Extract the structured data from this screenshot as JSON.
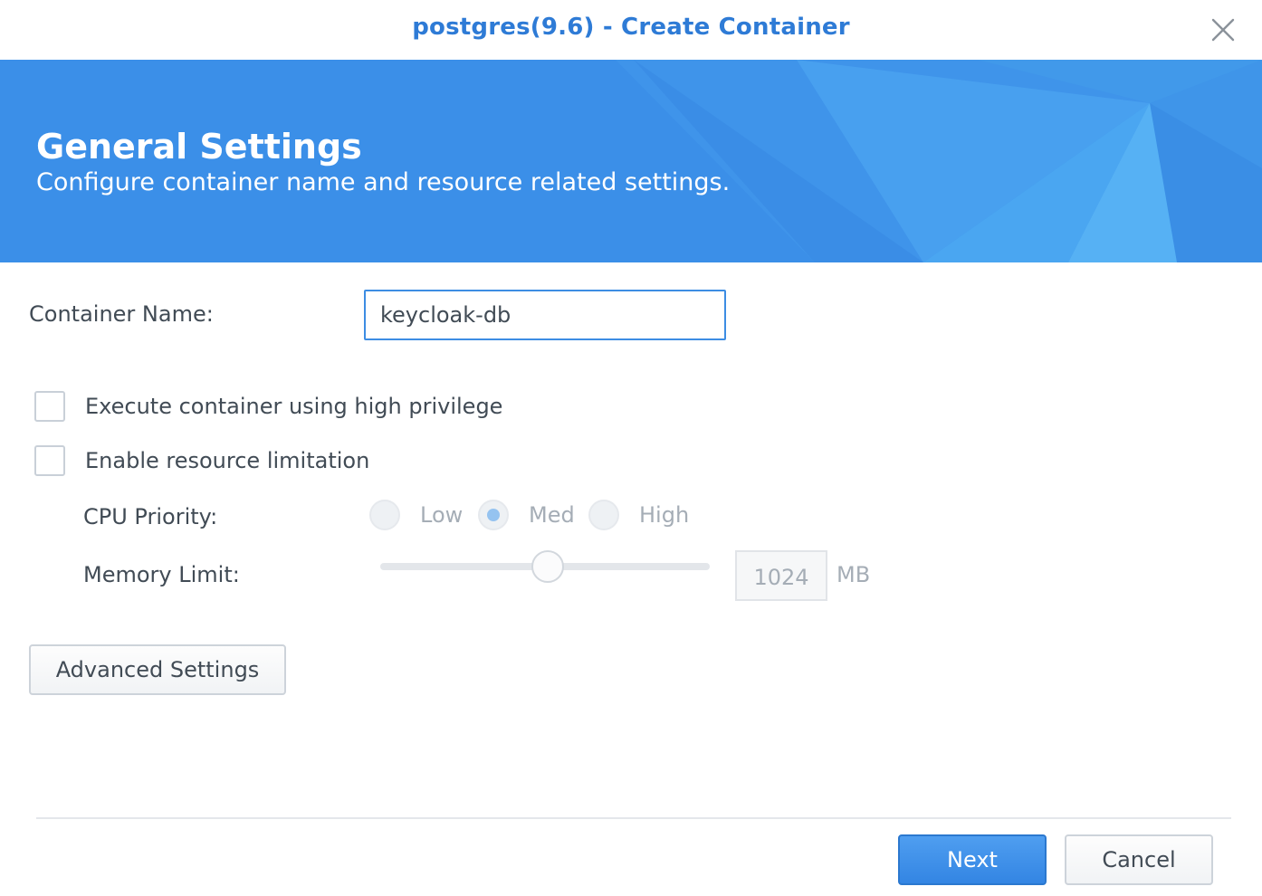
{
  "window": {
    "title": "postgres(9.6) - Create Container",
    "close_icon": "close-icon"
  },
  "banner": {
    "title": "General Settings",
    "subtitle": "Configure container name and resource related settings."
  },
  "form": {
    "container_name_label": "Container Name:",
    "container_name_value": "keycloak-db",
    "high_privilege_label": "Execute container using high privilege",
    "high_privilege_checked": false,
    "resource_limit_label": "Enable resource limitation",
    "resource_limit_checked": false,
    "cpu_priority_label": "CPU Priority:",
    "cpu_priority_options": [
      "Low",
      "Med",
      "High"
    ],
    "cpu_priority_selected": "Med",
    "memory_limit_label": "Memory Limit:",
    "memory_limit_value": "1024",
    "memory_limit_unit": "MB",
    "advanced_settings_label": "Advanced Settings"
  },
  "footer": {
    "next_label": "Next",
    "cancel_label": "Cancel"
  },
  "colors": {
    "accent": "#2e7bd6",
    "banner": "#3b8fe8",
    "primary_button": "#3385e3"
  }
}
